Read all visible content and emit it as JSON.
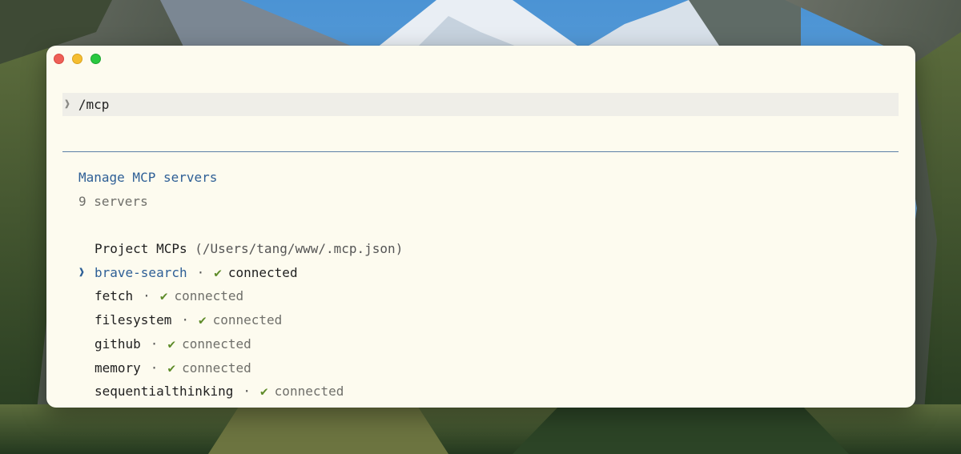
{
  "terminal": {
    "command": "/mcp"
  },
  "mcp": {
    "title": "Manage MCP servers",
    "count_label": "9 servers",
    "section_label": "Project MCPs",
    "section_path": "(/Users/tang/www/.mcp.json)",
    "servers": [
      {
        "name": "brave-search",
        "status": "connected",
        "selected": true
      },
      {
        "name": "fetch",
        "status": "connected",
        "selected": false
      },
      {
        "name": "filesystem",
        "status": "connected",
        "selected": false
      },
      {
        "name": "github",
        "status": "connected",
        "selected": false
      },
      {
        "name": "memory",
        "status": "connected",
        "selected": false
      },
      {
        "name": "sequentialthinking",
        "status": "connected",
        "selected": false
      }
    ],
    "selection_cursor": "❱",
    "separator": "·",
    "check_glyph": "✔"
  },
  "prompt_glyph": "❱"
}
